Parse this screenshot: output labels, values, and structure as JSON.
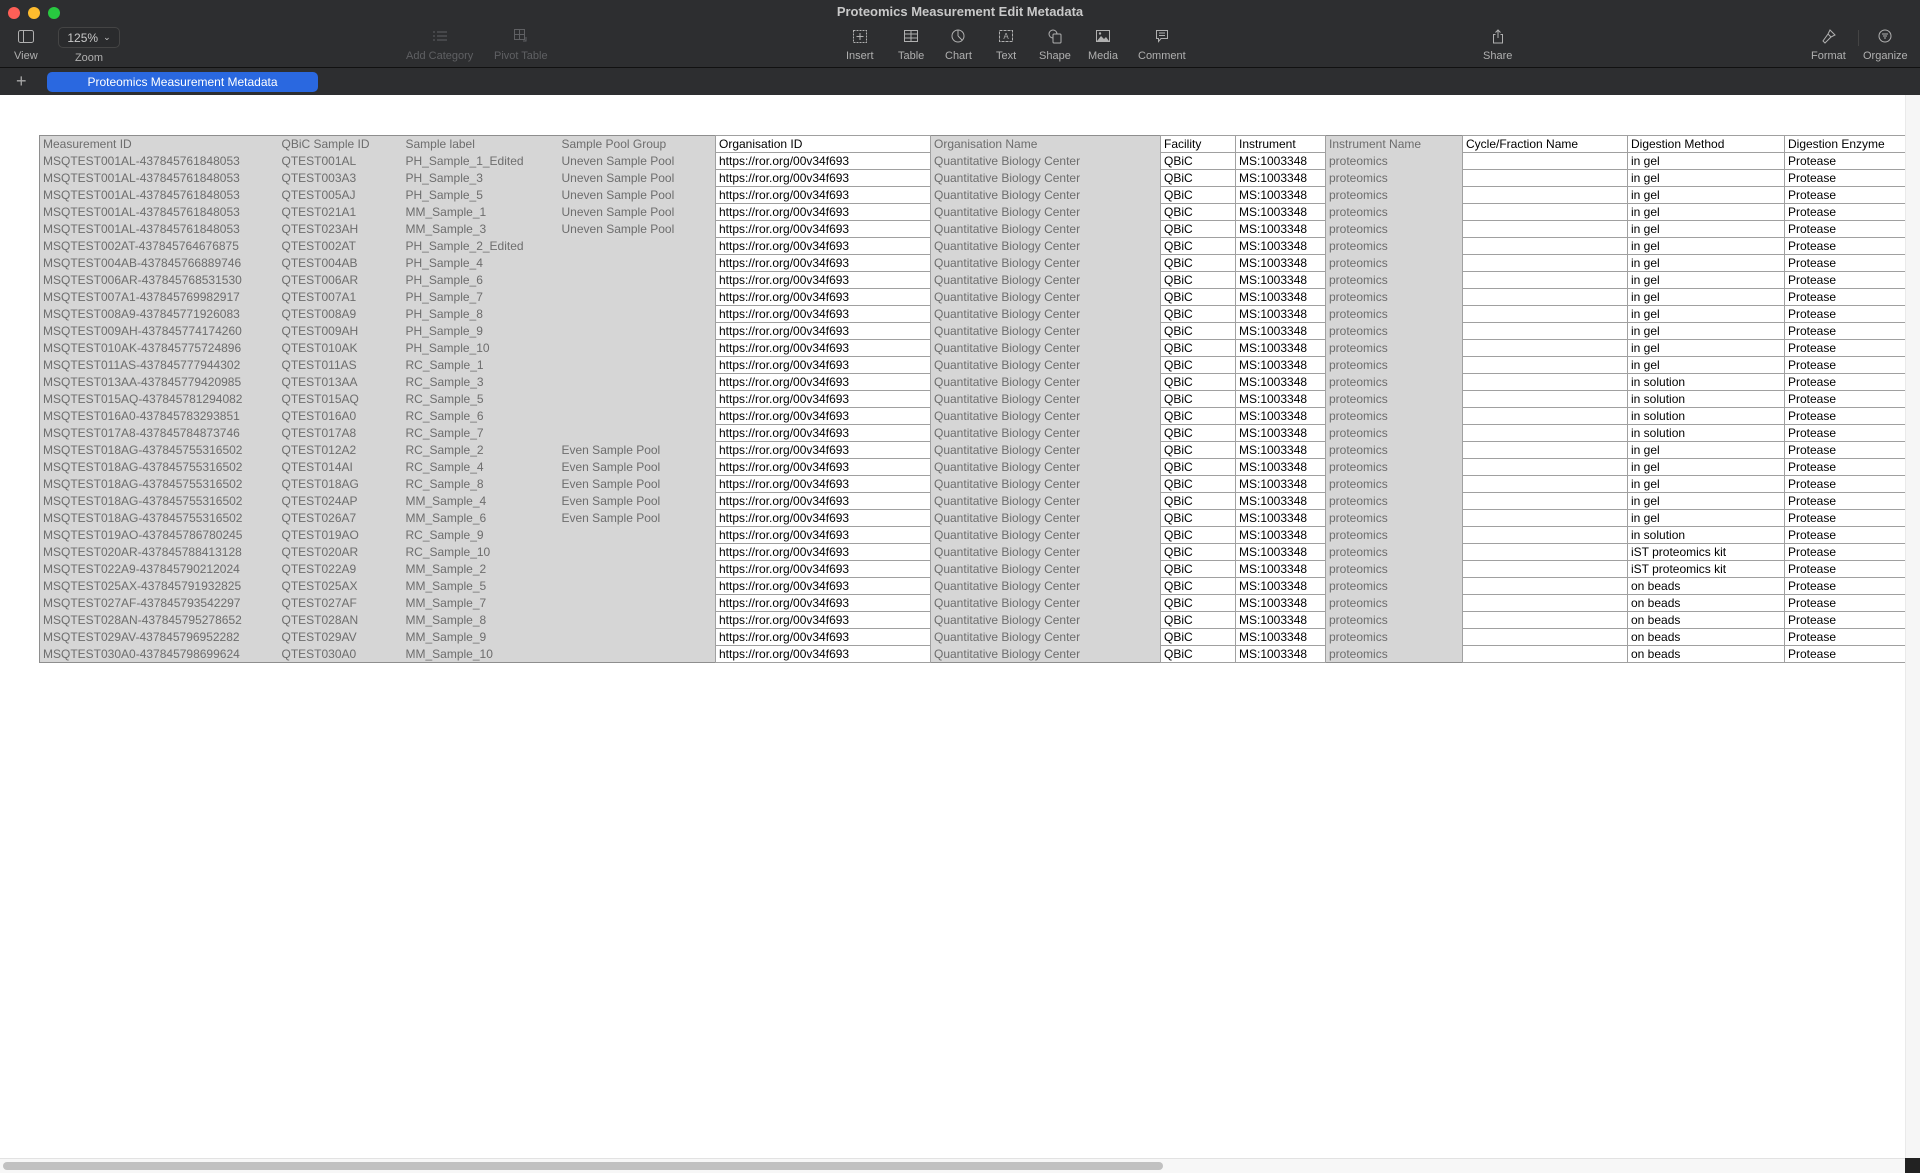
{
  "window": {
    "title": "Proteomics Measurement Edit Metadata"
  },
  "toolbar": {
    "view_label": "View",
    "zoom_value": "125%",
    "zoom_label": "Zoom",
    "add_category_label": "Add Category",
    "pivot_table_label": "Pivot Table",
    "insert_label": "Insert",
    "table_label": "Table",
    "chart_label": "Chart",
    "text_label": "Text",
    "shape_label": "Shape",
    "media_label": "Media",
    "comment_label": "Comment",
    "share_label": "Share",
    "format_label": "Format",
    "organize_label": "Organize"
  },
  "tabs": {
    "add_label": "+",
    "active": "Proteomics Measurement Metadata"
  },
  "colors": {
    "accent": "#2a68e0",
    "readonly_cell": "#d6d6d6",
    "toolbar": "#2d2e30"
  },
  "table": {
    "headers": [
      "Measurement ID",
      "QBiC Sample ID",
      "Sample label",
      "Sample Pool Group",
      "Organisation ID",
      "Organisation Name",
      "Facility",
      "Instrument",
      "Instrument Name",
      "Cycle/Fraction Name",
      "Digestion Method",
      "Digestion Enzyme"
    ],
    "rows": [
      [
        "MSQTEST001AL-437845761848053",
        "QTEST001AL",
        "PH_Sample_1_Edited",
        "Uneven Sample Pool",
        "https://ror.org/00v34f693",
        "Quantitative Biology Center",
        "QBiC",
        "MS:1003348",
        "proteomics",
        "",
        "in gel",
        "Protease"
      ],
      [
        "MSQTEST001AL-437845761848053",
        "QTEST003A3",
        "PH_Sample_3",
        "Uneven Sample Pool",
        "https://ror.org/00v34f693",
        "Quantitative Biology Center",
        "QBiC",
        "MS:1003348",
        "proteomics",
        "",
        "in gel",
        "Protease"
      ],
      [
        "MSQTEST001AL-437845761848053",
        "QTEST005AJ",
        "PH_Sample_5",
        "Uneven Sample Pool",
        "https://ror.org/00v34f693",
        "Quantitative Biology Center",
        "QBiC",
        "MS:1003348",
        "proteomics",
        "",
        "in gel",
        "Protease"
      ],
      [
        "MSQTEST001AL-437845761848053",
        "QTEST021A1",
        "MM_Sample_1",
        "Uneven Sample Pool",
        "https://ror.org/00v34f693",
        "Quantitative Biology Center",
        "QBiC",
        "MS:1003348",
        "proteomics",
        "",
        "in gel",
        "Protease"
      ],
      [
        "MSQTEST001AL-437845761848053",
        "QTEST023AH",
        "MM_Sample_3",
        "Uneven Sample Pool",
        "https://ror.org/00v34f693",
        "Quantitative Biology Center",
        "QBiC",
        "MS:1003348",
        "proteomics",
        "",
        "in gel",
        "Protease"
      ],
      [
        "MSQTEST002AT-437845764676875",
        "QTEST002AT",
        "PH_Sample_2_Edited",
        "",
        "https://ror.org/00v34f693",
        "Quantitative Biology Center",
        "QBiC",
        "MS:1003348",
        "proteomics",
        "",
        "in gel",
        "Protease"
      ],
      [
        "MSQTEST004AB-437845766889746",
        "QTEST004AB",
        "PH_Sample_4",
        "",
        "https://ror.org/00v34f693",
        "Quantitative Biology Center",
        "QBiC",
        "MS:1003348",
        "proteomics",
        "",
        "in gel",
        "Protease"
      ],
      [
        "MSQTEST006AR-437845768531530",
        "QTEST006AR",
        "PH_Sample_6",
        "",
        "https://ror.org/00v34f693",
        "Quantitative Biology Center",
        "QBiC",
        "MS:1003348",
        "proteomics",
        "",
        "in gel",
        "Protease"
      ],
      [
        "MSQTEST007A1-437845769982917",
        "QTEST007A1",
        "PH_Sample_7",
        "",
        "https://ror.org/00v34f693",
        "Quantitative Biology Center",
        "QBiC",
        "MS:1003348",
        "proteomics",
        "",
        "in gel",
        "Protease"
      ],
      [
        "MSQTEST008A9-437845771926083",
        "QTEST008A9",
        "PH_Sample_8",
        "",
        "https://ror.org/00v34f693",
        "Quantitative Biology Center",
        "QBiC",
        "MS:1003348",
        "proteomics",
        "",
        "in gel",
        "Protease"
      ],
      [
        "MSQTEST009AH-437845774174260",
        "QTEST009AH",
        "PH_Sample_9",
        "",
        "https://ror.org/00v34f693",
        "Quantitative Biology Center",
        "QBiC",
        "MS:1003348",
        "proteomics",
        "",
        "in gel",
        "Protease"
      ],
      [
        "MSQTEST010AK-437845775724896",
        "QTEST010AK",
        "PH_Sample_10",
        "",
        "https://ror.org/00v34f693",
        "Quantitative Biology Center",
        "QBiC",
        "MS:1003348",
        "proteomics",
        "",
        "in gel",
        "Protease"
      ],
      [
        "MSQTEST011AS-437845777944302",
        "QTEST011AS",
        "RC_Sample_1",
        "",
        "https://ror.org/00v34f693",
        "Quantitative Biology Center",
        "QBiC",
        "MS:1003348",
        "proteomics",
        "",
        "in gel",
        "Protease"
      ],
      [
        "MSQTEST013AA-437845779420985",
        "QTEST013AA",
        "RC_Sample_3",
        "",
        "https://ror.org/00v34f693",
        "Quantitative Biology Center",
        "QBiC",
        "MS:1003348",
        "proteomics",
        "",
        "in solution",
        "Protease"
      ],
      [
        "MSQTEST015AQ-437845781294082",
        "QTEST015AQ",
        "RC_Sample_5",
        "",
        "https://ror.org/00v34f693",
        "Quantitative Biology Center",
        "QBiC",
        "MS:1003348",
        "proteomics",
        "",
        "in solution",
        "Protease"
      ],
      [
        "MSQTEST016A0-437845783293851",
        "QTEST016A0",
        "RC_Sample_6",
        "",
        "https://ror.org/00v34f693",
        "Quantitative Biology Center",
        "QBiC",
        "MS:1003348",
        "proteomics",
        "",
        "in solution",
        "Protease"
      ],
      [
        "MSQTEST017A8-437845784873746",
        "QTEST017A8",
        "RC_Sample_7",
        "",
        "https://ror.org/00v34f693",
        "Quantitative Biology Center",
        "QBiC",
        "MS:1003348",
        "proteomics",
        "",
        "in solution",
        "Protease"
      ],
      [
        "MSQTEST018AG-437845755316502",
        "QTEST012A2",
        "RC_Sample_2",
        "Even Sample Pool",
        "https://ror.org/00v34f693",
        "Quantitative Biology Center",
        "QBiC",
        "MS:1003348",
        "proteomics",
        "",
        "in gel",
        "Protease"
      ],
      [
        "MSQTEST018AG-437845755316502",
        "QTEST014AI",
        "RC_Sample_4",
        "Even Sample Pool",
        "https://ror.org/00v34f693",
        "Quantitative Biology Center",
        "QBiC",
        "MS:1003348",
        "proteomics",
        "",
        "in gel",
        "Protease"
      ],
      [
        "MSQTEST018AG-437845755316502",
        "QTEST018AG",
        "RC_Sample_8",
        "Even Sample Pool",
        "https://ror.org/00v34f693",
        "Quantitative Biology Center",
        "QBiC",
        "MS:1003348",
        "proteomics",
        "",
        "in gel",
        "Protease"
      ],
      [
        "MSQTEST018AG-437845755316502",
        "QTEST024AP",
        "MM_Sample_4",
        "Even Sample Pool",
        "https://ror.org/00v34f693",
        "Quantitative Biology Center",
        "QBiC",
        "MS:1003348",
        "proteomics",
        "",
        "in gel",
        "Protease"
      ],
      [
        "MSQTEST018AG-437845755316502",
        "QTEST026A7",
        "MM_Sample_6",
        "Even Sample Pool",
        "https://ror.org/00v34f693",
        "Quantitative Biology Center",
        "QBiC",
        "MS:1003348",
        "proteomics",
        "",
        "in gel",
        "Protease"
      ],
      [
        "MSQTEST019AO-437845786780245",
        "QTEST019AO",
        "RC_Sample_9",
        "",
        "https://ror.org/00v34f693",
        "Quantitative Biology Center",
        "QBiC",
        "MS:1003348",
        "proteomics",
        "",
        "in solution",
        "Protease"
      ],
      [
        "MSQTEST020AR-437845788413128",
        "QTEST020AR",
        "RC_Sample_10",
        "",
        "https://ror.org/00v34f693",
        "Quantitative Biology Center",
        "QBiC",
        "MS:1003348",
        "proteomics",
        "",
        "iST proteomics kit",
        "Protease"
      ],
      [
        "MSQTEST022A9-437845790212024",
        "QTEST022A9",
        "MM_Sample_2",
        "",
        "https://ror.org/00v34f693",
        "Quantitative Biology Center",
        "QBiC",
        "MS:1003348",
        "proteomics",
        "",
        "iST proteomics kit",
        "Protease"
      ],
      [
        "MSQTEST025AX-437845791932825",
        "QTEST025AX",
        "MM_Sample_5",
        "",
        "https://ror.org/00v34f693",
        "Quantitative Biology Center",
        "QBiC",
        "MS:1003348",
        "proteomics",
        "",
        "on beads",
        "Protease"
      ],
      [
        "MSQTEST027AF-437845793542297",
        "QTEST027AF",
        "MM_Sample_7",
        "",
        "https://ror.org/00v34f693",
        "Quantitative Biology Center",
        "QBiC",
        "MS:1003348",
        "proteomics",
        "",
        "on beads",
        "Protease"
      ],
      [
        "MSQTEST028AN-437845795278652",
        "QTEST028AN",
        "MM_Sample_8",
        "",
        "https://ror.org/00v34f693",
        "Quantitative Biology Center",
        "QBiC",
        "MS:1003348",
        "proteomics",
        "",
        "on beads",
        "Protease"
      ],
      [
        "MSQTEST029AV-437845796952282",
        "QTEST029AV",
        "MM_Sample_9",
        "",
        "https://ror.org/00v34f693",
        "Quantitative Biology Center",
        "QBiC",
        "MS:1003348",
        "proteomics",
        "",
        "on beads",
        "Protease"
      ],
      [
        "MSQTEST030A0-437845798699624",
        "QTEST030A0",
        "MM_Sample_10",
        "",
        "https://ror.org/00v34f693",
        "Quantitative Biology Center",
        "QBiC",
        "MS:1003348",
        "proteomics",
        "",
        "on beads",
        "Protease"
      ]
    ]
  }
}
